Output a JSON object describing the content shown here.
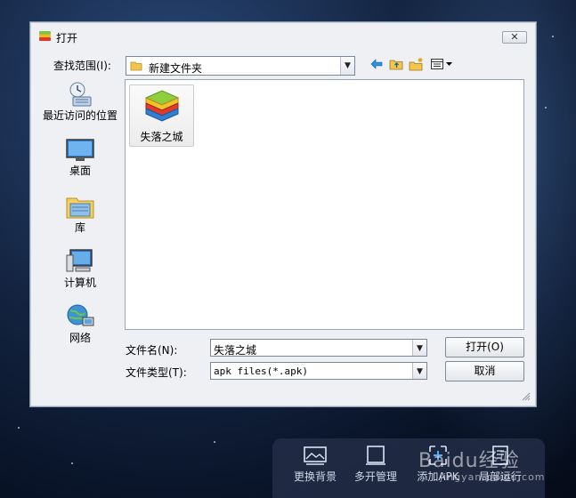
{
  "dialog": {
    "title": "打开",
    "close_label": "✕",
    "look_in_label": "查找范围(I):",
    "look_in_value": "新建文件夹",
    "places": [
      {
        "label": "最近访问的位置",
        "icon": "recent-places-icon"
      },
      {
        "label": "桌面",
        "icon": "desktop-icon"
      },
      {
        "label": "库",
        "icon": "libraries-icon"
      },
      {
        "label": "计算机",
        "icon": "computer-icon"
      },
      {
        "label": "网络",
        "icon": "network-icon"
      }
    ],
    "files": [
      {
        "name": "失落之城",
        "icon": "bluestacks-app-icon"
      }
    ],
    "file_name_label": "文件名(N):",
    "file_name_value": "失落之城",
    "file_type_label": "文件类型(T):",
    "file_type_value": "apk files(*.apk)",
    "open_label": "打开(O)",
    "cancel_label": "取消"
  },
  "toolbar": {
    "items": [
      {
        "label": "更换背景",
        "icon": "change-background-icon"
      },
      {
        "label": "多开管理",
        "icon": "multi-instance-icon"
      },
      {
        "label": "添加APK",
        "icon": "add-apk-icon"
      },
      {
        "label": "局部运行",
        "icon": "partial-run-icon"
      }
    ]
  },
  "watermark": {
    "brand": "Baidu经验",
    "url": "jingyan.baidu.com"
  }
}
